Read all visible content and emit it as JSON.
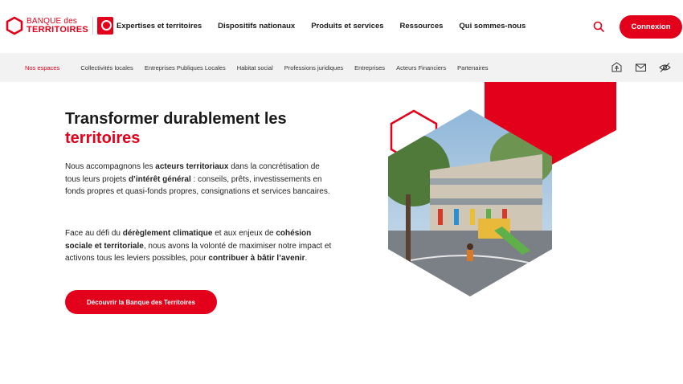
{
  "brand": {
    "line1": "BANQUE des",
    "line2": "TERRITOIRES",
    "accent": "#e2001a"
  },
  "mainnav": {
    "items": [
      "Expertises et territoires",
      "Dispositifs nationaux",
      "Produits et services",
      "Ressources",
      "Qui sommes-nous"
    ],
    "search_icon": "search-icon",
    "connexion_label": "Connexion"
  },
  "subnav": {
    "active_label": "Nos espaces",
    "items": [
      "Collectivités locales",
      "Entreprises Publiques Locales",
      "Habitat social",
      "Professions juridiques",
      "Entreprises",
      "Acteurs Financiers",
      "Partenaires"
    ],
    "icons": [
      "accessibility-icon",
      "mail-icon",
      "hide-eye-icon"
    ]
  },
  "hero": {
    "title_line1": "Transformer durablement les",
    "title_line2": "territoires",
    "p1": [
      {
        "t": "Nous accompagnons les ",
        "b": false
      },
      {
        "t": "acteurs territoriaux",
        "b": true
      },
      {
        "t": " dans la concrétisation de tous leurs projets ",
        "b": false
      },
      {
        "t": "d’intérêt général",
        "b": true
      },
      {
        "t": " : conseils, prêts, investissements en fonds propres et quasi-fonds propres, consignations et services bancaires.",
        "b": false
      }
    ],
    "p2": [
      {
        "t": "Face au défi du ",
        "b": false
      },
      {
        "t": "dérèglement climatique",
        "b": true
      },
      {
        "t": " et aux enjeux de ",
        "b": false
      },
      {
        "t": "cohésion sociale et territoriale",
        "b": true
      },
      {
        "t": ", nous avons la volonté de maximiser notre impact et activons tous les leviers possibles, pour ",
        "b": false
      },
      {
        "t": "contribuer à bâtir l’avenir",
        "b": true
      },
      {
        "t": ".",
        "b": false
      }
    ],
    "cta_label": "Découvrir la Banque des Territoires"
  }
}
